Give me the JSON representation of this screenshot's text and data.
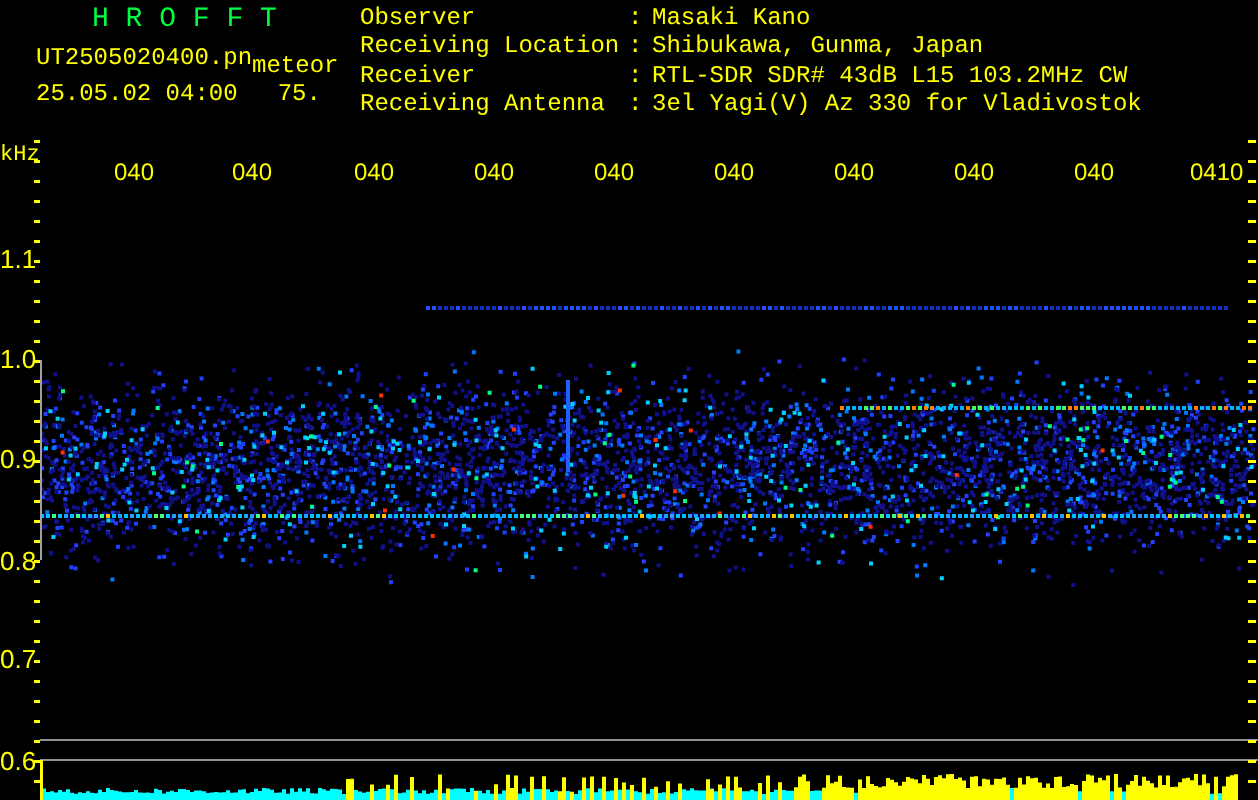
{
  "header": {
    "title": "H R O F F T",
    "filename": "UT2505020400.pn",
    "mode": "meteor",
    "timestamp": "25.05.02 04:00",
    "reading": "75."
  },
  "station": [
    {
      "label": "Observer",
      "separator": ":",
      "value": "Masaki Kano"
    },
    {
      "label": "Receiving Location",
      "separator": ":",
      "value": "Shibukawa, Gunma, Japan"
    },
    {
      "label": "Receiver",
      "separator": ":",
      "value": "RTL-SDR SDR# 43dB L15 103.2MHz CW"
    },
    {
      "label": "Receiving Antenna",
      "separator": ":",
      "value": "3el Yagi(V) Az 330 for Vladivostok"
    }
  ],
  "plot": {
    "unit": "kHz",
    "time_labels": [
      "040",
      "040",
      "040",
      "040",
      "040",
      "040",
      "040",
      "040",
      "040",
      "0410"
    ],
    "freq_labels": [
      "1.1",
      "1.0",
      "0.9",
      "0.8",
      "0.7",
      "0.6"
    ]
  }
}
